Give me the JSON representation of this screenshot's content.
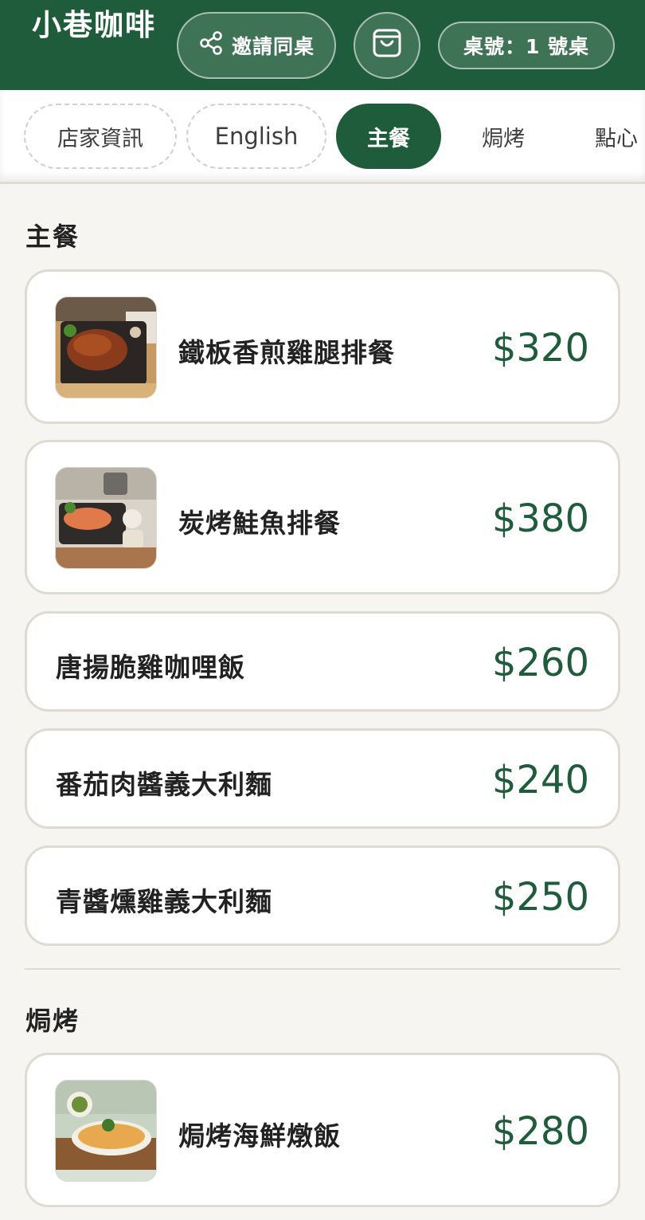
{
  "header": {
    "brand": "小巷咖啡",
    "invite_label": "邀請同桌",
    "table_label": "桌號：1 號桌",
    "colors": {
      "primary": "#1f5c3b",
      "background": "#f7f5f1"
    },
    "icons": {
      "invite": "share-icon",
      "cart": "shopping-bag-icon"
    }
  },
  "tabs": [
    {
      "label": "店家資訊"
    },
    {
      "label": "English"
    },
    {
      "label": "主餐"
    },
    {
      "label": "焗烤"
    },
    {
      "label": "點心"
    }
  ],
  "sections": [
    {
      "title": "主餐",
      "items": [
        {
          "name": "鐵板香煎雞腿排餐",
          "price": "$320"
        },
        {
          "name": "炭烤鮭魚排餐",
          "price": "$380"
        },
        {
          "name": "唐揚脆雞咖哩飯",
          "price": "$260"
        },
        {
          "name": "番茄肉醬義大利麵",
          "price": "$240"
        },
        {
          "name": "青醬燻雞義大利麵",
          "price": "$250"
        }
      ]
    },
    {
      "title": "焗烤",
      "items": [
        {
          "name": "焗烤海鮮燉飯",
          "price": "$280"
        }
      ]
    }
  ]
}
